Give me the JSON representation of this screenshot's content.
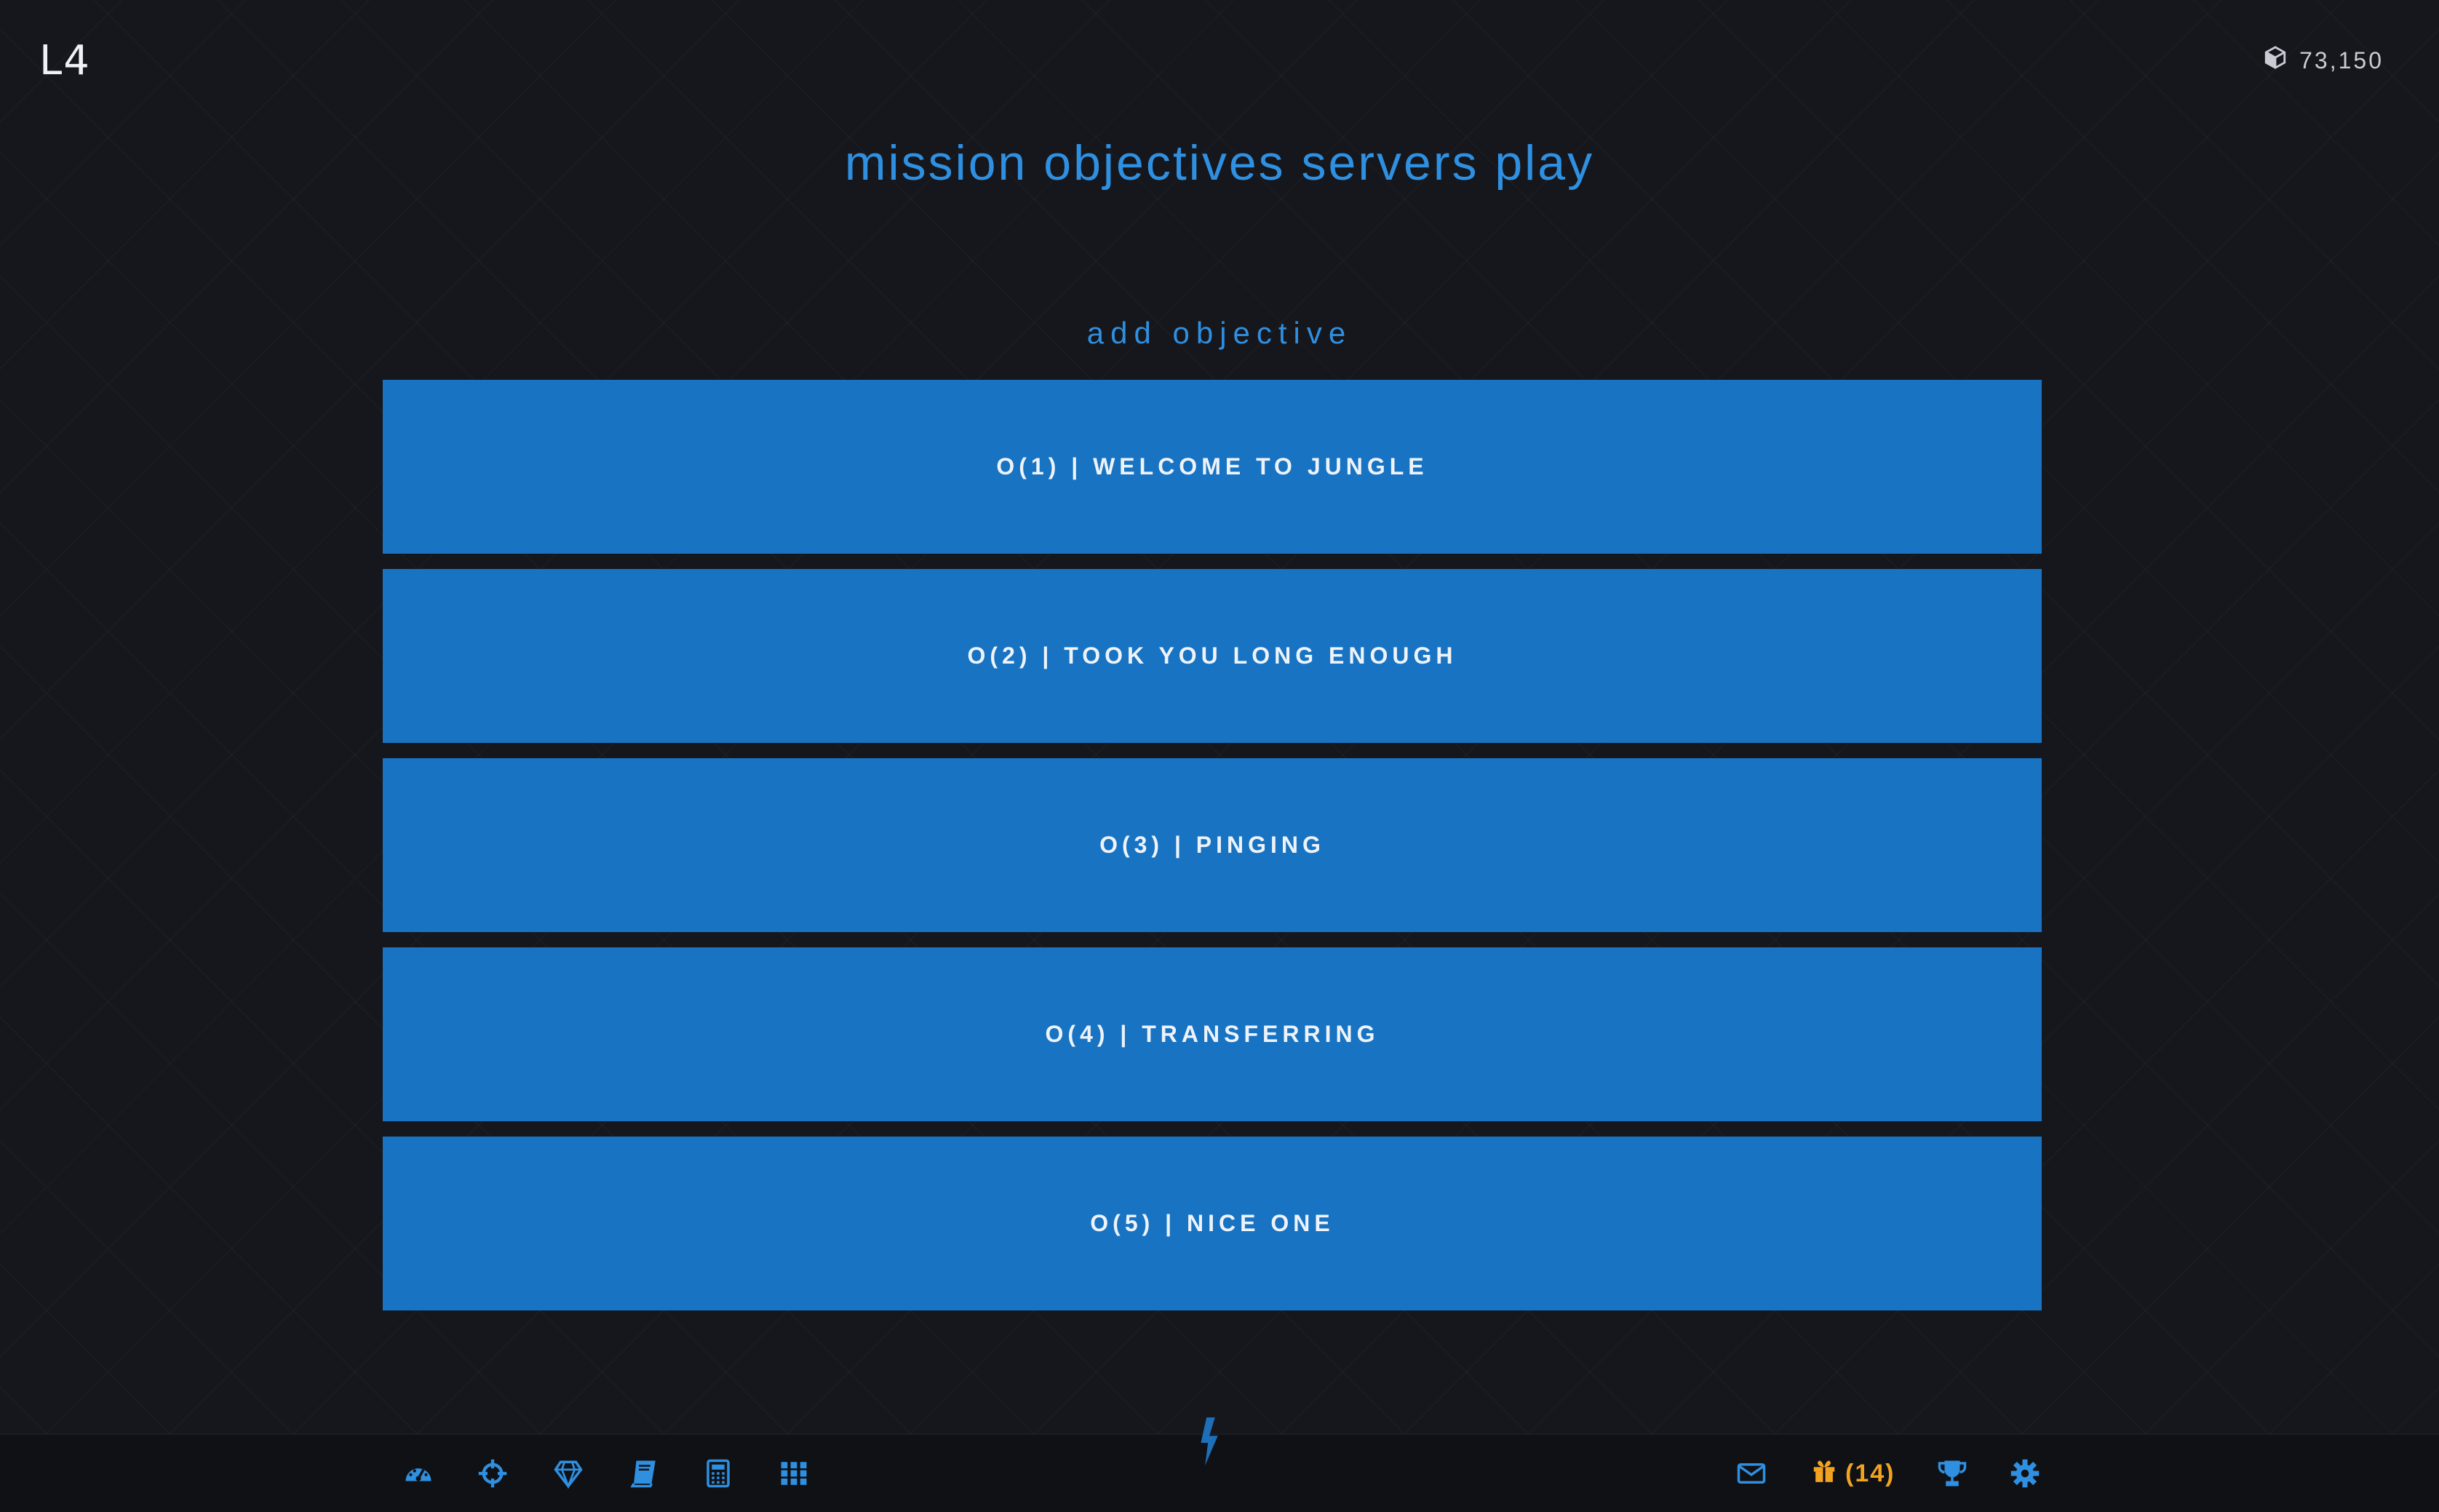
{
  "header": {
    "logo": "L4",
    "currency_icon": "cube-icon",
    "currency_value": "73,150"
  },
  "title": "mission objectives servers play",
  "add_objective_label": "add objective",
  "objectives": [
    {
      "label": "O(1) | WELCOME TO JUNGLE"
    },
    {
      "label": "O(2) | TOOK YOU LONG ENOUGH"
    },
    {
      "label": "O(3) | PINGING"
    },
    {
      "label": "O(4) | TRANSFERRING"
    },
    {
      "label": "O(5) | NICE ONE"
    }
  ],
  "footer": {
    "left_icons": [
      "dashboard-icon",
      "crosshair-icon",
      "gem-icon",
      "book-icon",
      "calculator-icon",
      "grid-icon"
    ],
    "center_icon": "lightning-bolt-icon",
    "right_icons": [
      "mail-icon",
      "gift-icon",
      "trophy-icon",
      "gear-icon"
    ],
    "gift_count": "(14)"
  },
  "colors": {
    "accent": "#2f8fe0",
    "button": "#1873c2",
    "gift": "#f2a320",
    "background": "#15171c"
  }
}
